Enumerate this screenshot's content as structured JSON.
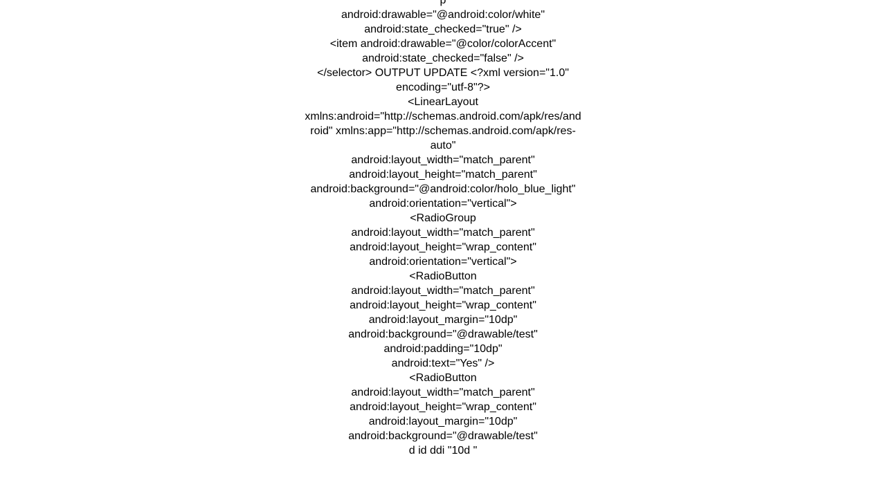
{
  "lines": [
    "p",
    "android:drawable=\"@android:color/white\" android:state_checked=\"true\" />",
    "<item android:drawable=\"@color/colorAccent\" android:state_checked=\"false\" />",
    "</selector>   OUTPUT   UPDATE <?xml version=\"1.0\" encoding=\"utf-8\"?>",
    "<LinearLayout xmlns:android=\"http://schemas.android.com/apk/res/android\"     xmlns:app=\"http://schemas.android.com/apk/res-auto\"",
    "android:layout_width=\"match_parent\"",
    "android:layout_height=\"match_parent\"",
    "android:background=\"@android:color/holo_blue_light\"",
    "android:orientation=\"vertical\">",
    "<RadioGroup",
    "android:layout_width=\"match_parent\"",
    "android:layout_height=\"wrap_content\"",
    "android:orientation=\"vertical\">",
    "<RadioButton",
    "android:layout_width=\"match_parent\"",
    "android:layout_height=\"wrap_content\"",
    "android:layout_margin=\"10dp\"",
    "android:background=\"@drawable/test\"",
    "android:padding=\"10dp\"",
    "android:text=\"Yes\" />",
    "<RadioButton",
    "android:layout_width=\"match_parent\"",
    "android:layout_height=\"wrap_content\"",
    "android:layout_margin=\"10dp\"",
    "android:background=\"@drawable/test\"",
    "d id ddi \"10d \""
  ]
}
